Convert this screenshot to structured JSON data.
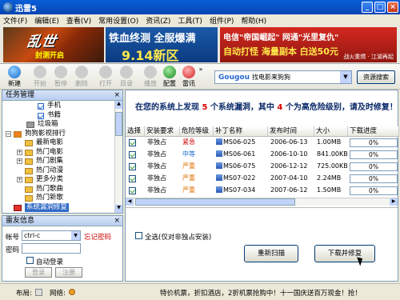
{
  "window": {
    "title": "迅雷5",
    "min": "_",
    "max": "□",
    "close": "×"
  },
  "menu": [
    "文件(F)",
    "编辑(E)",
    "查看(V)",
    "常用设置(O)",
    "资讯(Z)",
    "工具(T)",
    "组件(P)",
    "帮助(H)"
  ],
  "banner": {
    "game_title": "乱世",
    "game_sub": "封测开启",
    "mid_line1": "铁血终测 全服爆满",
    "mid_line2": "9.14新区",
    "right_line1": "电信\"帝国崛起\" 网通\"光里复仇\"",
    "right_line2": "自动打怪 海量副本 白送50元",
    "right_small": "战火重燃 · 江湖再起"
  },
  "toolbar": {
    "buttons": [
      {
        "label": "新建",
        "icon": "new-icon",
        "enabled": true
      },
      {
        "label": "开始",
        "icon": "play-icon",
        "enabled": false
      },
      {
        "label": "暂停",
        "icon": "pause-icon",
        "enabled": false
      },
      {
        "label": "删除",
        "icon": "delete-icon",
        "enabled": false
      },
      {
        "label": "打开",
        "icon": "open-icon",
        "enabled": false
      },
      {
        "label": "目录",
        "icon": "folder-icon",
        "enabled": false
      },
      {
        "label": "播放",
        "icon": "media-icon",
        "enabled": false
      },
      {
        "label": "配置",
        "icon": "config-icon",
        "enabled": true
      },
      {
        "label": "雷讯",
        "icon": "chat-icon",
        "enabled": true
      }
    ],
    "more": "»"
  },
  "search": {
    "logo": "Gougou",
    "text": "找电影来狗狗",
    "button": "资源搜索"
  },
  "task_panel": {
    "title": "任务管理",
    "close": "×",
    "items": [
      {
        "label": "手机",
        "type": "check",
        "checked": true,
        "indent": 2
      },
      {
        "label": "书籍",
        "type": "check",
        "checked": true,
        "indent": 2
      },
      {
        "label": "垃圾箱",
        "type": "folder",
        "indent": 1
      },
      {
        "label": "狗狗影视排行",
        "type": "group",
        "indent": 0,
        "expanded": true
      },
      {
        "label": "最新电影",
        "type": "folder",
        "indent": 1
      },
      {
        "label": "热门电影",
        "type": "folder",
        "indent": 1,
        "pm": "+"
      },
      {
        "label": "热门剧集",
        "type": "folder",
        "indent": 1,
        "pm": "+"
      },
      {
        "label": "热门动漫",
        "type": "folder",
        "indent": 1
      },
      {
        "label": "更多分类",
        "type": "folder",
        "indent": 1,
        "pm": "+"
      },
      {
        "label": "热门歌曲",
        "type": "folder",
        "indent": 1
      },
      {
        "label": "热门新歌",
        "type": "folder",
        "indent": 1
      },
      {
        "label": "系统漏洞修复",
        "type": "folder",
        "indent": 0,
        "selected": true
      }
    ]
  },
  "thunder_panel": {
    "title": "雷友信息",
    "close": "×",
    "account_label": "帐号",
    "account_value": "ctrl-c",
    "forgot": "忘记密码",
    "password_label": "密码",
    "auto_login": "自动登录",
    "login_btn": "登录",
    "register_btn": "注册"
  },
  "main": {
    "msg_prefix": "在您的系统上发现",
    "total": "5",
    "msg_mid": "个系统漏洞，其中",
    "high": "4",
    "msg_suffix": "个为高危险级别，请及时修复！"
  },
  "table": {
    "headers": [
      "选择",
      "安装要求",
      "危险等级",
      "补丁名称",
      "发布时间",
      "大小",
      "下载进度"
    ],
    "rows": [
      {
        "req": "非独占",
        "level": "紧急",
        "level_color": "#d00000",
        "name": "MS06-025",
        "date": "2006-06-13",
        "size": "1.00MB",
        "progress": "0%"
      },
      {
        "req": "非独占",
        "level": "中等",
        "level_color": "#1a6ad0",
        "name": "MS06-061",
        "date": "2006-10-10",
        "size": "841.00KB",
        "progress": "0%"
      },
      {
        "req": "非独占",
        "level": "严重",
        "level_color": "#e07000",
        "name": "MS06-075",
        "date": "2006-12-12",
        "size": "725.00KB",
        "progress": "0%"
      },
      {
        "req": "非独占",
        "level": "严重",
        "level_color": "#e07000",
        "name": "MS07-022",
        "date": "2007-04-10",
        "size": "2.24MB",
        "progress": "0%"
      },
      {
        "req": "非独占",
        "level": "严重",
        "level_color": "#e07000",
        "name": "MS07-034",
        "date": "2007-06-12",
        "size": "1.50MB",
        "progress": "0%"
      }
    ]
  },
  "bottom": {
    "select_all": "全选(仅对非独占安装)",
    "rescan": "重新扫描",
    "download_fix": "下载并修复"
  },
  "status": {
    "layout_label": "布局:",
    "network_label": "网络:",
    "ad": "特价机票，折扣酒店，2折机票抢购中！十一国庆送百万现金！抢！"
  },
  "colors": {
    "title_bar": "#0a5fd8",
    "selection": "#316ac5",
    "danger": "#d00000",
    "highlight_num": "#dd0000"
  }
}
